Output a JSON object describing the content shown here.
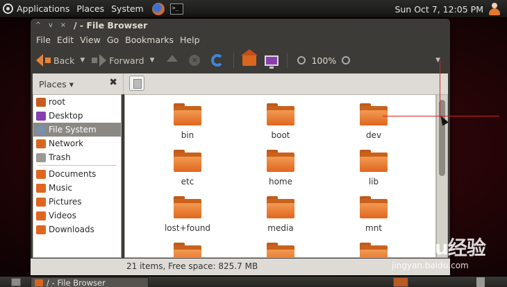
{
  "top_panel": {
    "menus": [
      "Applications",
      "Places",
      "System"
    ],
    "clock": "Sun Oct  7, 12:05 PM"
  },
  "window": {
    "title": "/ - File Browser",
    "controls": [
      "^",
      "v",
      "×"
    ],
    "menubar": [
      "File",
      "Edit",
      "View",
      "Go",
      "Bookmarks",
      "Help"
    ],
    "toolbar": {
      "back_label": "Back",
      "forward_label": "Forward",
      "zoom_level": "100%"
    },
    "sidebar": {
      "header": "Places ▾",
      "items": [
        {
          "label": "root",
          "color": "#c95a1e"
        },
        {
          "label": "Desktop",
          "color": "#8a3fb0"
        },
        {
          "label": "File System",
          "color": "#7b8fa8",
          "selected": true
        },
        {
          "label": "Network",
          "color": "#d9661f"
        },
        {
          "label": "Trash",
          "color": "#9a9994"
        }
      ],
      "bookmarks": [
        {
          "label": "Documents",
          "color": "#e0661f"
        },
        {
          "label": "Music",
          "color": "#e0661f"
        },
        {
          "label": "Pictures",
          "color": "#e0661f"
        },
        {
          "label": "Videos",
          "color": "#e0661f"
        },
        {
          "label": "Downloads",
          "color": "#e0661f"
        }
      ]
    },
    "folders": [
      "bin",
      "boot",
      "dev",
      "etc",
      "home",
      "lib",
      "lost+found",
      "media",
      "mnt",
      "",
      "",
      ""
    ],
    "status": "21 items, Free space: 825.7 MB"
  },
  "taskbar": {
    "window_button": "/ - File Browser"
  },
  "watermark": {
    "logo": "Baidu经验",
    "url": "jingyan.baidu.com"
  }
}
